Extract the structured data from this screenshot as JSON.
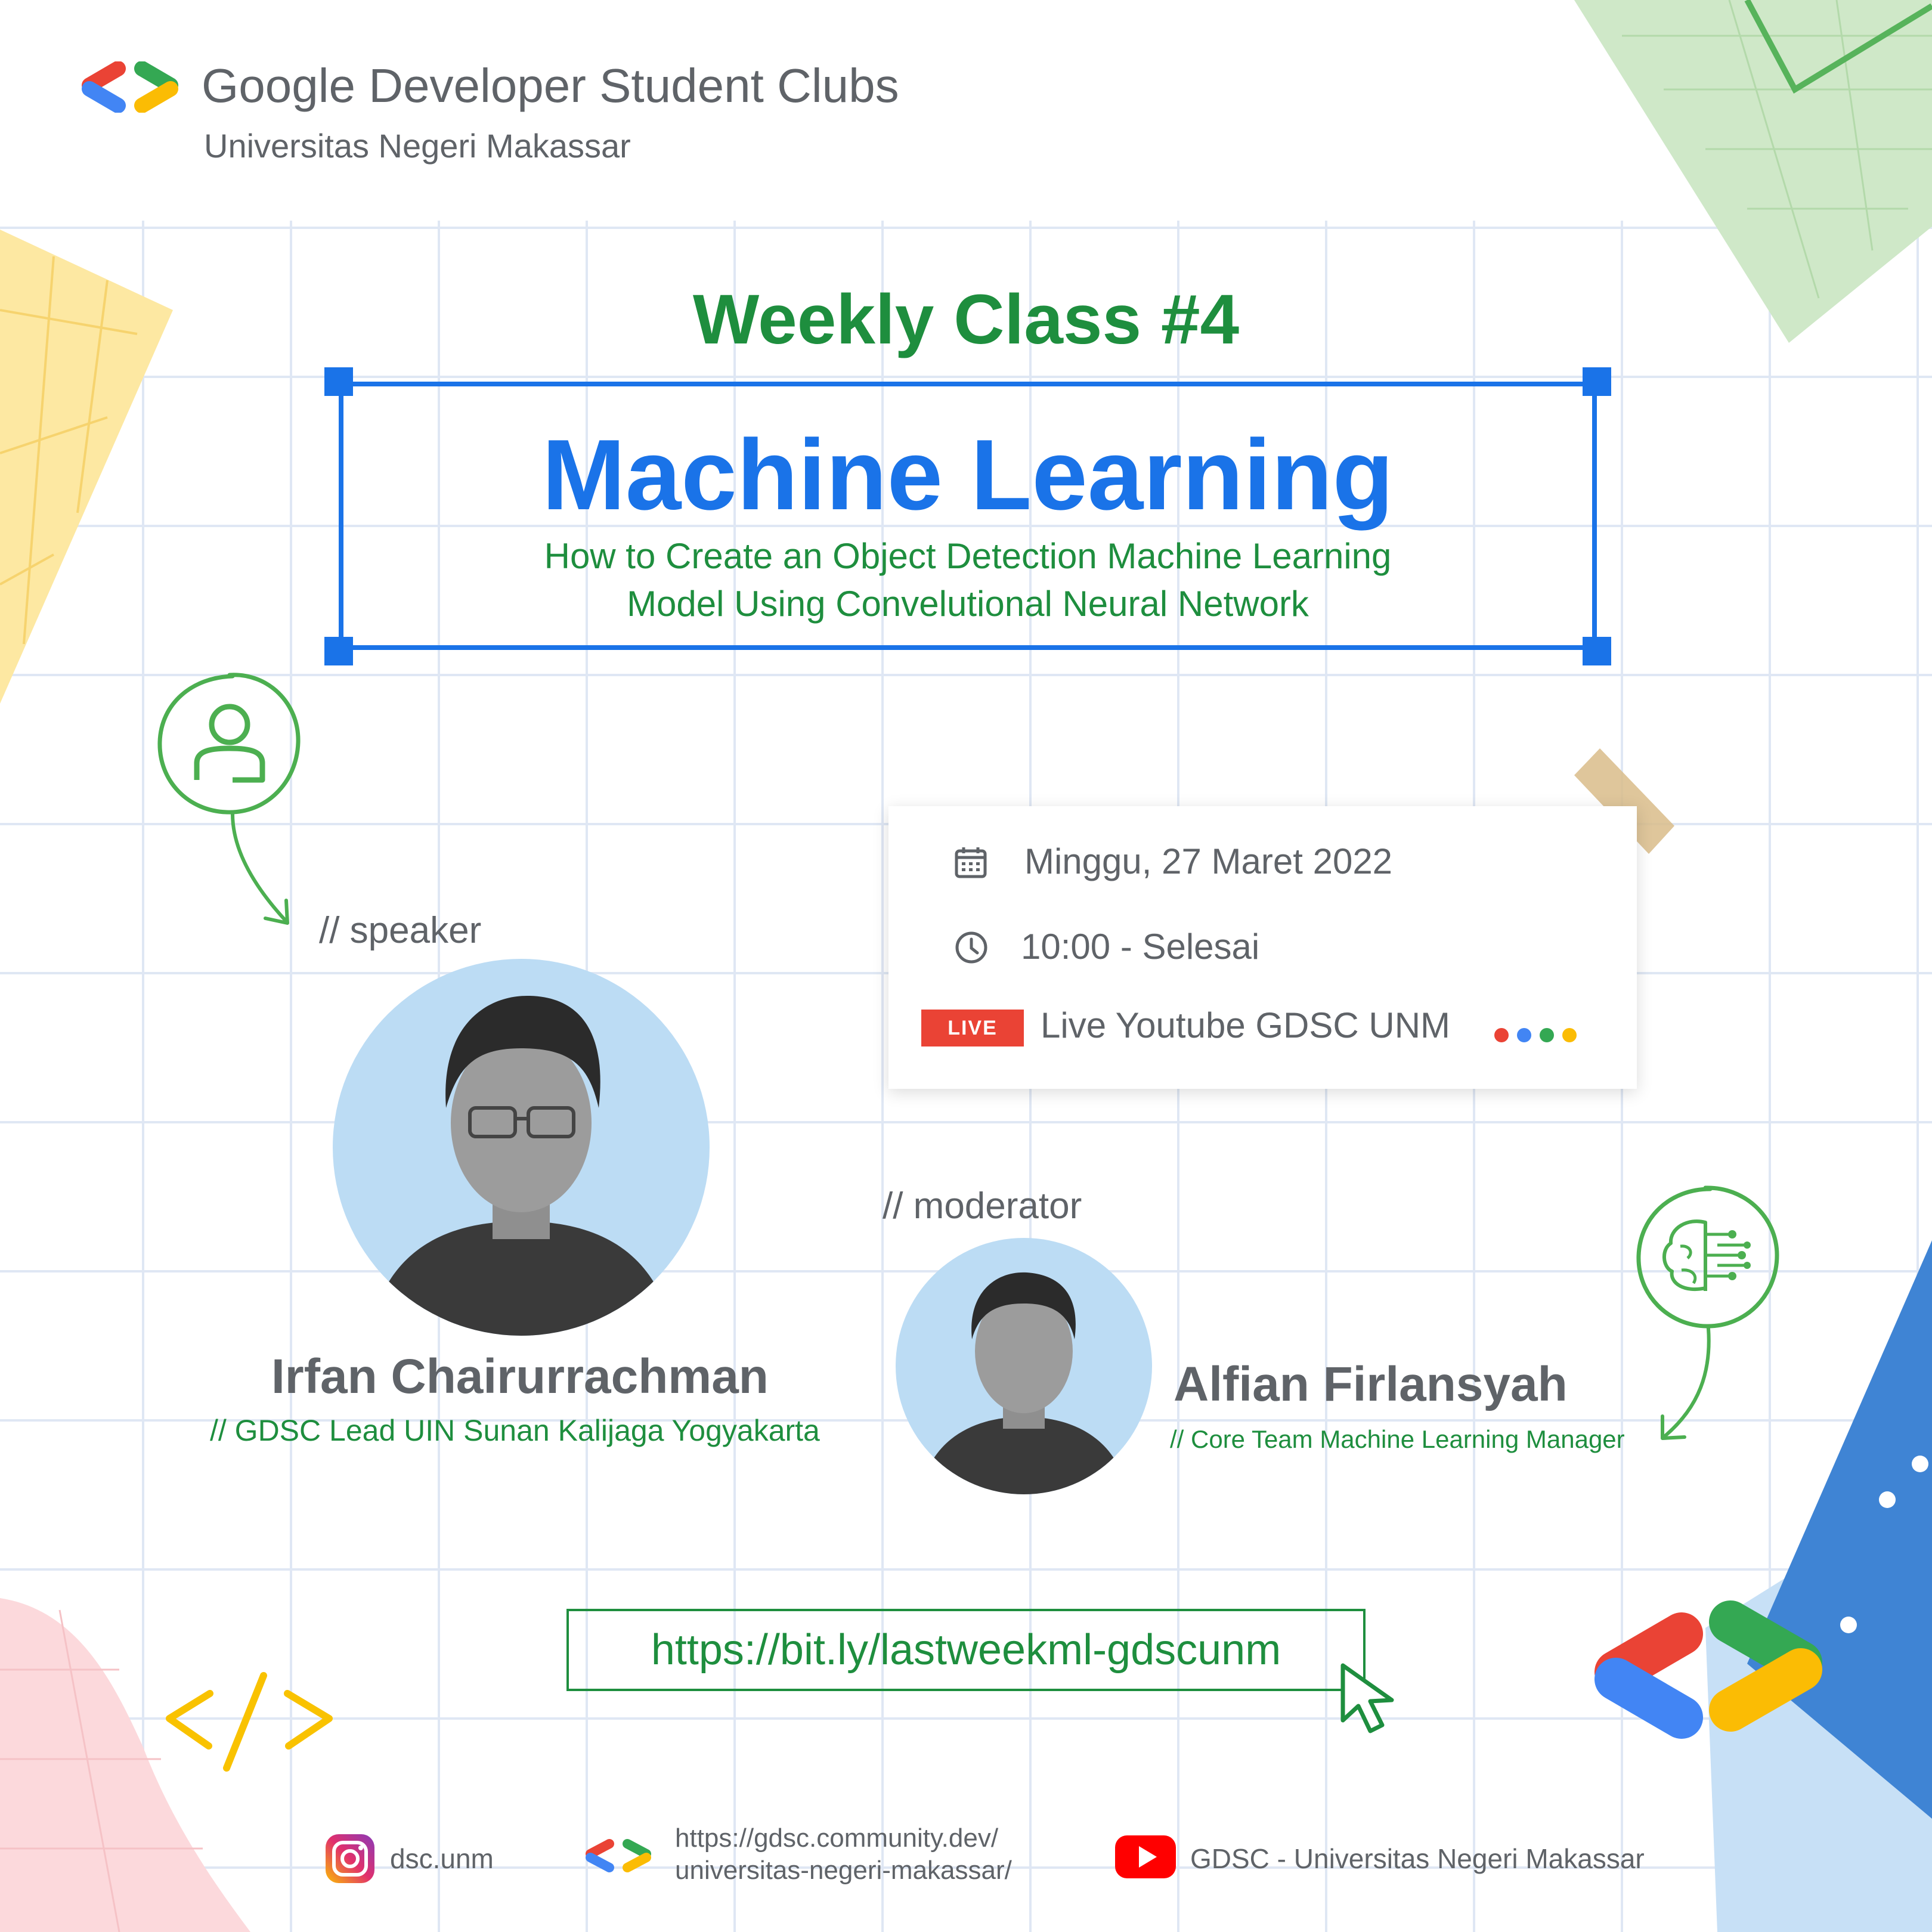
{
  "colors": {
    "google_blue": "#1a73e8",
    "google_green": "#1e8e3e",
    "google_red": "#ea4335",
    "google_yellow": "#fbbc04",
    "text_grey": "#5f6368"
  },
  "header": {
    "logo_icon": "gdsc-brackets-icon",
    "title": "Google Developer Student Clubs",
    "subtitle": "Universitas Negeri Makassar"
  },
  "event": {
    "series": "Weekly Class #4",
    "title": "Machine Learning",
    "subtitle_line1": "How to Create an Object Detection Machine Learning",
    "subtitle_line2": "Model Using Convelutional Neural Network"
  },
  "speaker": {
    "role_label": "// speaker",
    "name": "Irfan Chairurrachman",
    "affiliation": "// GDSC Lead UIN Sunan Kalijaga Yogyakarta",
    "icon": "person-icon"
  },
  "moderator": {
    "role_label": "// moderator",
    "name": "Alfian Firlansyah",
    "affiliation": "// Core Team Machine Learning Manager",
    "icon": "brain-icon"
  },
  "schedule": {
    "date_icon": "calendar-icon",
    "date": "Minggu, 27 Maret 2022",
    "time_icon": "clock-icon",
    "time": "10:00 - Selesai",
    "live_badge": "LIVE",
    "platform": "Live Youtube GDSC UNM"
  },
  "registration": {
    "link": "https://bit.ly/lastweekml-gdscunm",
    "cursor_icon": "cursor-icon"
  },
  "footer": {
    "instagram_icon": "instagram-icon",
    "instagram": "dsc.unm",
    "website_icon": "gdsc-brackets-icon",
    "website_line1": "https://gdsc.community.dev/",
    "website_line2": "universitas-negeri-makassar/",
    "youtube_icon": "youtube-icon",
    "youtube": "GDSC - Universitas Negeri Makassar"
  }
}
